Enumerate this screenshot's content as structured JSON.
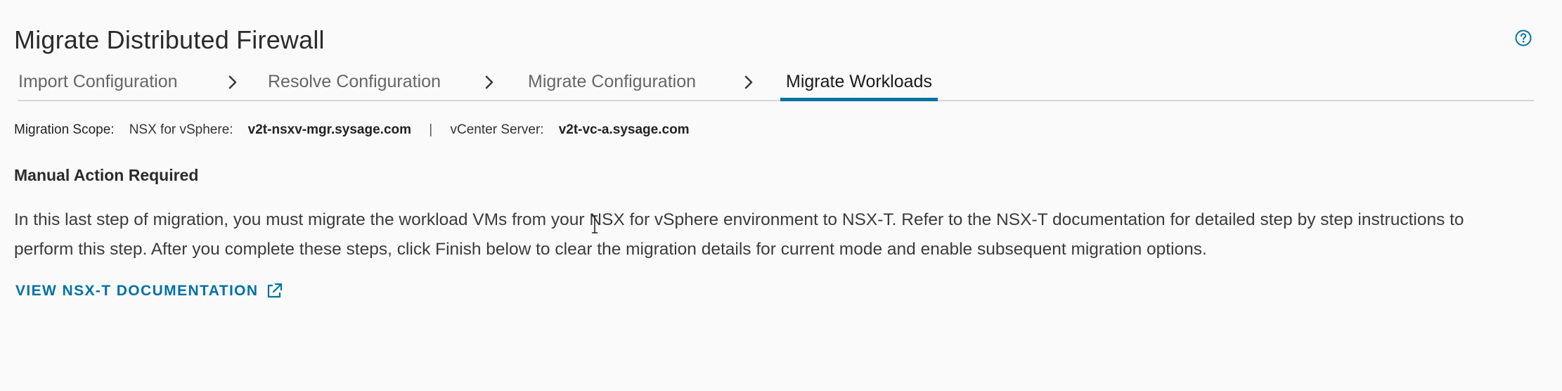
{
  "header": {
    "title": "Migrate Distributed Firewall",
    "help_icon": "help-circle-icon"
  },
  "wizard": {
    "steps": [
      {
        "label": "Import Configuration",
        "active": false
      },
      {
        "label": "Resolve Configuration",
        "active": false
      },
      {
        "label": "Migrate Configuration",
        "active": false
      },
      {
        "label": "Migrate Workloads",
        "active": true
      }
    ],
    "separator_icon": "chevron-right-icon"
  },
  "scope": {
    "label": "Migration Scope:",
    "nsx_label": "NSX for vSphere:",
    "nsx_value": "v2t-nsxv-mgr.sysage.com",
    "separator": "|",
    "vcenter_label": "vCenter Server:",
    "vcenter_value": "v2t-vc-a.sysage.com"
  },
  "content": {
    "heading": "Manual Action Required",
    "description": "In this last step of migration, you must migrate the workload VMs from your NSX for vSphere environment to NSX-T. Refer to the NSX-T documentation for detailed step by step instructions to perform this step. After you complete these steps, click Finish below to clear the migration details for current mode and enable subsequent migration options.",
    "doc_link": "VIEW NSX-T DOCUMENTATION",
    "doc_link_icon": "external-link-icon"
  },
  "colors": {
    "accent": "#0072a3",
    "background": "#fafafa",
    "text": "#333333"
  }
}
